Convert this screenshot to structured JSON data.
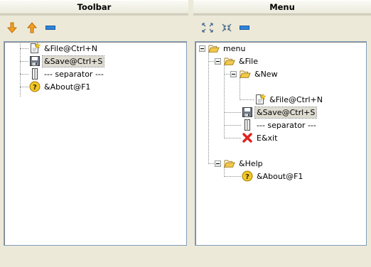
{
  "toolbar_panel": {
    "title": "Toolbar",
    "tools": [
      {
        "icon": "arrow-down-icon",
        "color": "#f0a020"
      },
      {
        "icon": "arrow-up-icon",
        "color": "#f0a020"
      },
      {
        "icon": "remove-icon",
        "color": "#2f84d8"
      }
    ],
    "items": [
      {
        "label": "&File@Ctrl+N",
        "icon": "new-file-icon",
        "selected": false
      },
      {
        "label": "&Save@Ctrl+S",
        "icon": "floppy-disk-icon",
        "selected": true
      },
      {
        "label": "--- separator ---",
        "icon": "separator-icon",
        "selected": false
      },
      {
        "label": "&About@F1",
        "icon": "help-icon",
        "selected": false
      }
    ]
  },
  "menu_panel": {
    "title": "Menu",
    "tools": [
      {
        "icon": "expand-all-icon",
        "color": "#4a6a8a"
      },
      {
        "icon": "collapse-all-icon",
        "color": "#4a6a8a"
      },
      {
        "icon": "remove-icon",
        "color": "#2f84d8"
      }
    ],
    "tree": {
      "root": "menu",
      "file": "&File",
      "new": "&New",
      "new_file": "&File@Ctrl+N",
      "save": "&Save@Ctrl+S",
      "separator": "--- separator ---",
      "exit": "E&xit",
      "help": "&Help",
      "about": "&About@F1"
    }
  },
  "colors": {
    "folder": "#f2c94c",
    "selection": "#dedbd0",
    "exit_icon": "#e02020"
  }
}
